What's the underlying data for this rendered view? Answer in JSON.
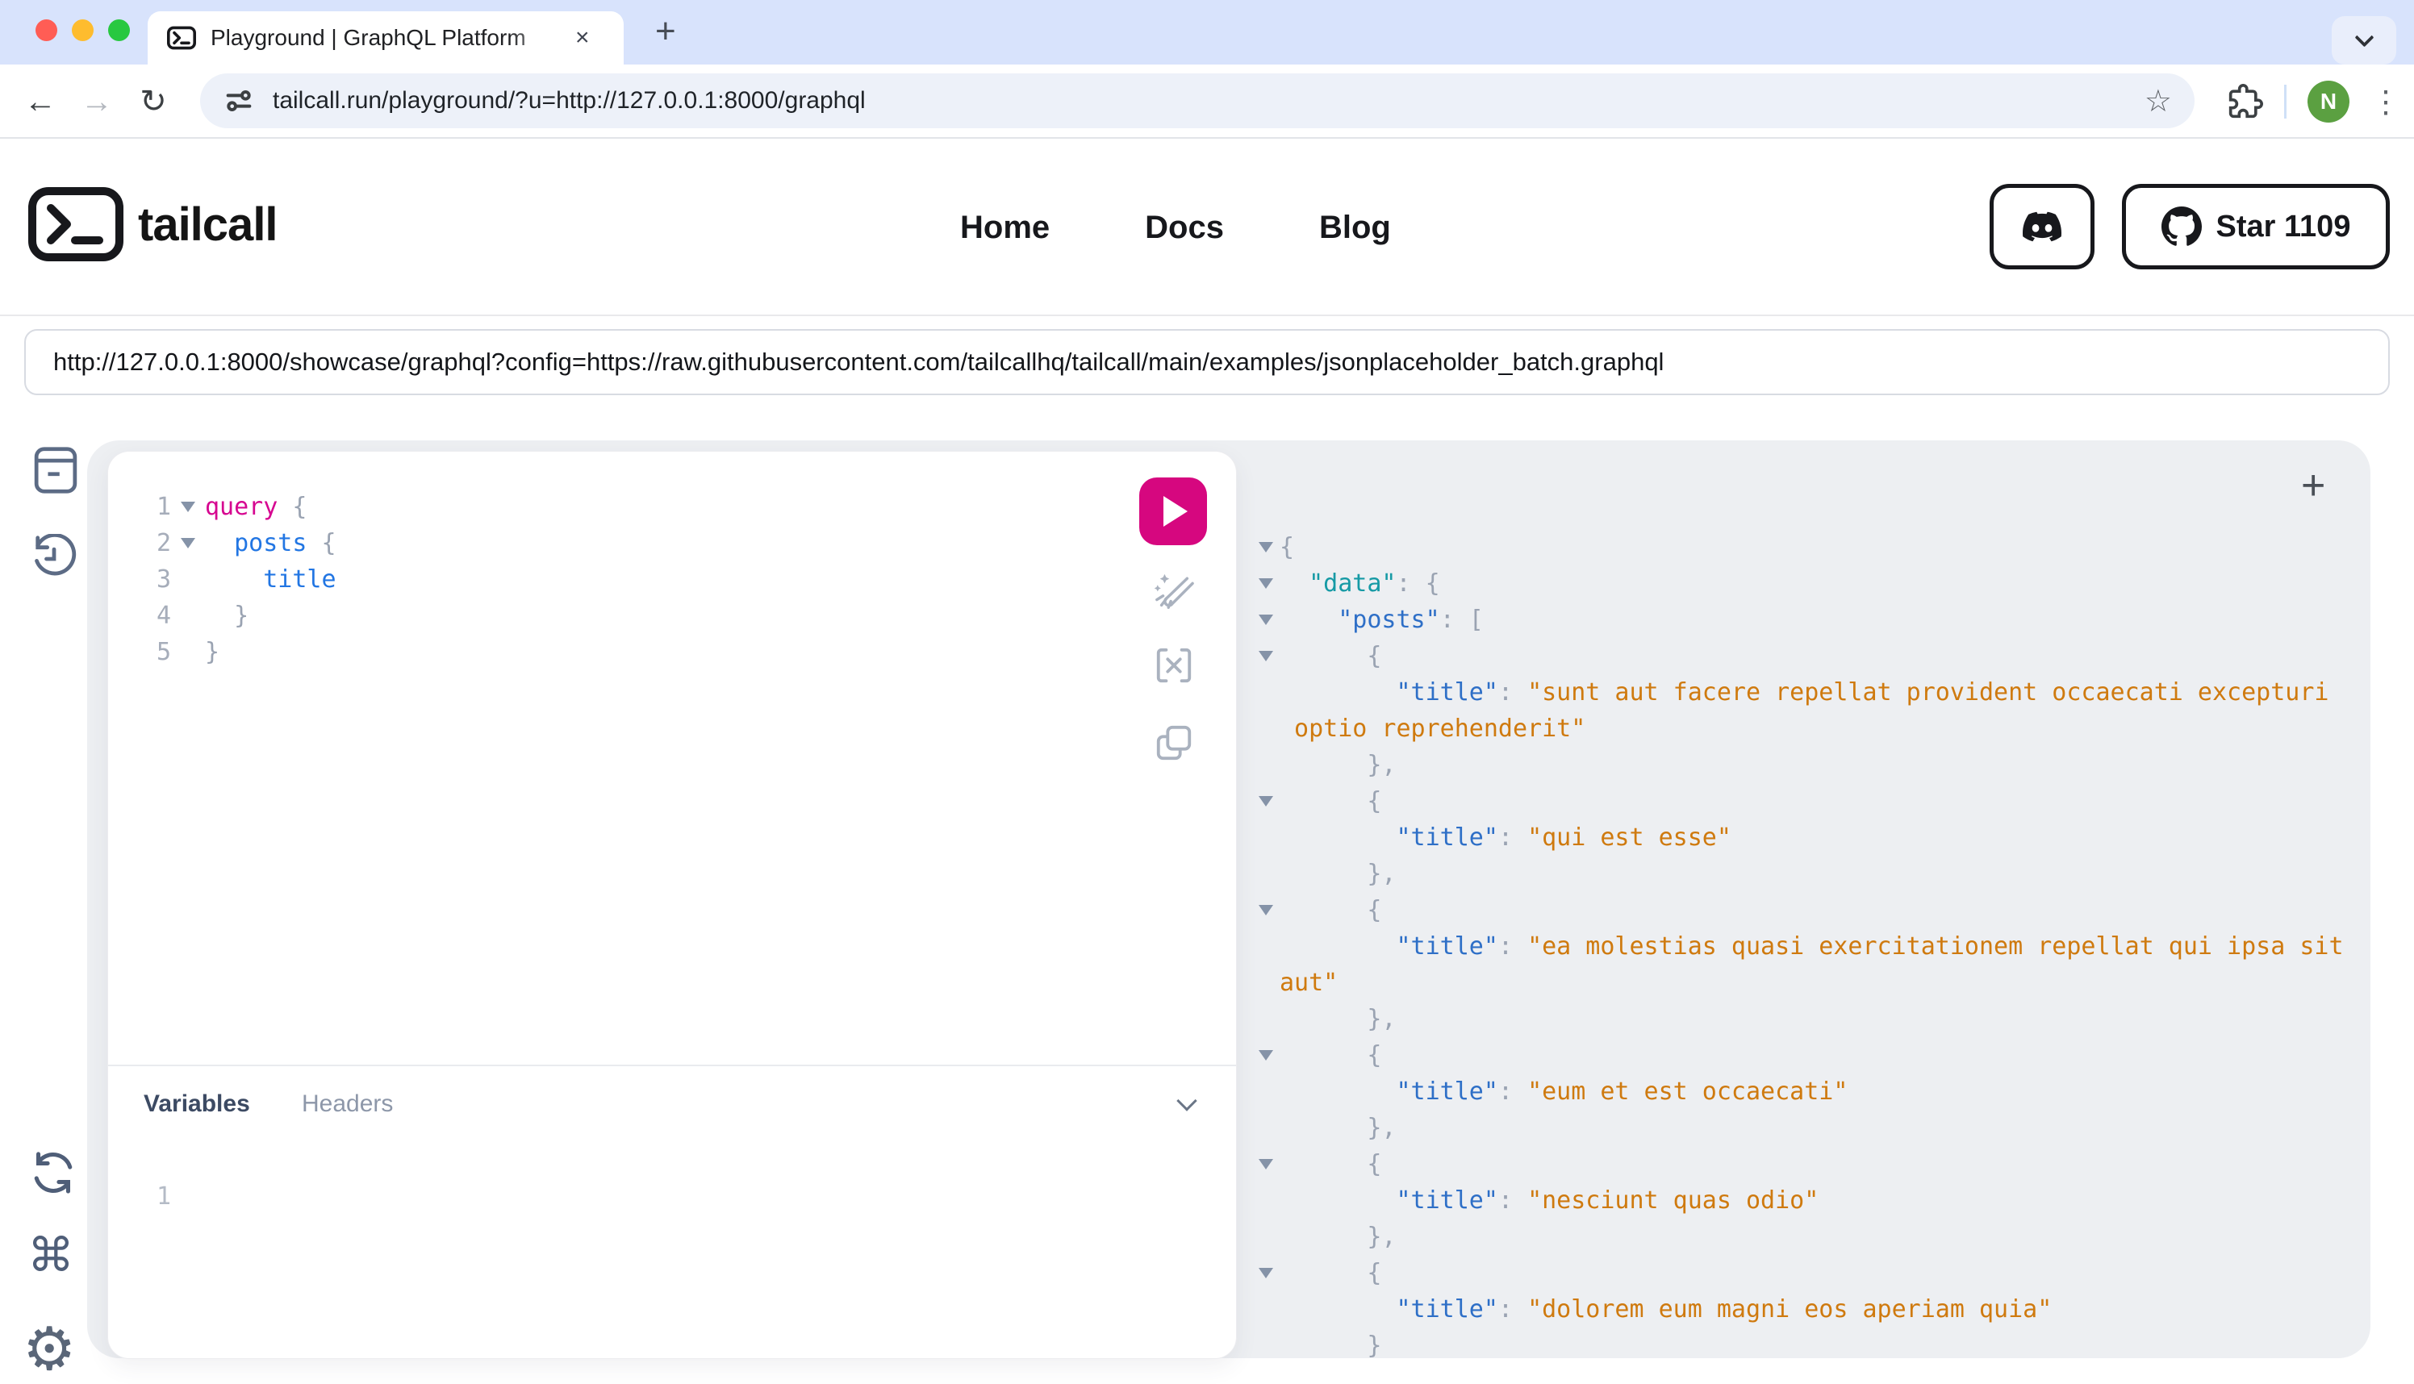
{
  "browser": {
    "tab_title": "Playground | GraphQL Platform",
    "url": "tailcall.run/playground/?u=http://127.0.0.1:8000/graphql",
    "avatar_initial": "N"
  },
  "header": {
    "brand": "tailcall",
    "nav": [
      {
        "label": "Home"
      },
      {
        "label": "Docs"
      },
      {
        "label": "Blog"
      }
    ],
    "github": {
      "label": "Star 1109"
    }
  },
  "playground": {
    "endpoint_url": "http://127.0.0.1:8000/showcase/graphql?config=https://raw.githubusercontent.com/tailcallhq/tailcall/main/examples/jsonplaceholder_batch.graphql",
    "tabs": {
      "variables": "Variables",
      "headers": "Headers"
    },
    "variables_gutter": "1",
    "response_add_label": "+",
    "query_lines": [
      {
        "num": "1",
        "fold": true,
        "segments": [
          {
            "c": "kw",
            "t": "query"
          },
          {
            "c": "punct",
            "t": " {"
          }
        ]
      },
      {
        "num": "2",
        "fold": true,
        "segments": [
          {
            "c": "punct",
            "t": "  "
          },
          {
            "c": "name",
            "t": "posts"
          },
          {
            "c": "punct",
            "t": " {"
          }
        ]
      },
      {
        "num": "3",
        "fold": false,
        "segments": [
          {
            "c": "punct",
            "t": "    "
          },
          {
            "c": "name",
            "t": "title"
          }
        ]
      },
      {
        "num": "4",
        "fold": false,
        "segments": [
          {
            "c": "punct",
            "t": "  }"
          }
        ]
      },
      {
        "num": "5",
        "fold": false,
        "segments": [
          {
            "c": "punct",
            "t": "}"
          }
        ]
      }
    ],
    "response_lines": [
      {
        "fold": true,
        "segments": [
          {
            "c": "punct",
            "t": "{"
          }
        ]
      },
      {
        "fold": true,
        "segments": [
          {
            "c": "punct",
            "t": "  "
          },
          {
            "c": "prop",
            "t": "\"data\""
          },
          {
            "c": "punct",
            "t": ": {"
          }
        ]
      },
      {
        "fold": true,
        "segments": [
          {
            "c": "punct",
            "t": "    "
          },
          {
            "c": "key",
            "t": "\"posts\""
          },
          {
            "c": "punct",
            "t": ": ["
          }
        ]
      },
      {
        "fold": true,
        "segments": [
          {
            "c": "punct",
            "t": "      {"
          }
        ]
      },
      {
        "fold": false,
        "segments": [
          {
            "c": "punct",
            "t": "        "
          },
          {
            "c": "key",
            "t": "\"title\""
          },
          {
            "c": "punct",
            "t": ": "
          },
          {
            "c": "str",
            "t": "\"sunt aut facere repellat provident occaecati excepturi"
          }
        ]
      },
      {
        "fold": false,
        "segments": [
          {
            "c": "str",
            "t": " optio reprehenderit\""
          }
        ]
      },
      {
        "fold": false,
        "segments": [
          {
            "c": "punct",
            "t": "      },"
          }
        ]
      },
      {
        "fold": true,
        "segments": [
          {
            "c": "punct",
            "t": "      {"
          }
        ]
      },
      {
        "fold": false,
        "segments": [
          {
            "c": "punct",
            "t": "        "
          },
          {
            "c": "key",
            "t": "\"title\""
          },
          {
            "c": "punct",
            "t": ": "
          },
          {
            "c": "str",
            "t": "\"qui est esse\""
          }
        ]
      },
      {
        "fold": false,
        "segments": [
          {
            "c": "punct",
            "t": "      },"
          }
        ]
      },
      {
        "fold": true,
        "segments": [
          {
            "c": "punct",
            "t": "      {"
          }
        ]
      },
      {
        "fold": false,
        "segments": [
          {
            "c": "punct",
            "t": "        "
          },
          {
            "c": "key",
            "t": "\"title\""
          },
          {
            "c": "punct",
            "t": ": "
          },
          {
            "c": "str",
            "t": "\"ea molestias quasi exercitationem repellat qui ipsa sit"
          }
        ]
      },
      {
        "fold": false,
        "segments": [
          {
            "c": "str",
            "t": "aut\""
          }
        ]
      },
      {
        "fold": false,
        "segments": [
          {
            "c": "punct",
            "t": "      },"
          }
        ]
      },
      {
        "fold": true,
        "segments": [
          {
            "c": "punct",
            "t": "      {"
          }
        ]
      },
      {
        "fold": false,
        "segments": [
          {
            "c": "punct",
            "t": "        "
          },
          {
            "c": "key",
            "t": "\"title\""
          },
          {
            "c": "punct",
            "t": ": "
          },
          {
            "c": "str",
            "t": "\"eum et est occaecati\""
          }
        ]
      },
      {
        "fold": false,
        "segments": [
          {
            "c": "punct",
            "t": "      },"
          }
        ]
      },
      {
        "fold": true,
        "segments": [
          {
            "c": "punct",
            "t": "      {"
          }
        ]
      },
      {
        "fold": false,
        "segments": [
          {
            "c": "punct",
            "t": "        "
          },
          {
            "c": "key",
            "t": "\"title\""
          },
          {
            "c": "punct",
            "t": ": "
          },
          {
            "c": "str",
            "t": "\"nesciunt quas odio\""
          }
        ]
      },
      {
        "fold": false,
        "segments": [
          {
            "c": "punct",
            "t": "      },"
          }
        ]
      },
      {
        "fold": true,
        "segments": [
          {
            "c": "punct",
            "t": "      {"
          }
        ]
      },
      {
        "fold": false,
        "segments": [
          {
            "c": "punct",
            "t": "        "
          },
          {
            "c": "key",
            "t": "\"title\""
          },
          {
            "c": "punct",
            "t": ": "
          },
          {
            "c": "str",
            "t": "\"dolorem eum magni eos aperiam quia\""
          }
        ]
      },
      {
        "fold": false,
        "segments": [
          {
            "c": "punct",
            "t": "      }"
          }
        ]
      }
    ]
  },
  "icons": {
    "tab_favicon": "tailcall-terminal-icon",
    "rail": [
      "docs-icon",
      "history-icon",
      "refetch-icon",
      "shortcuts-icon",
      "settings-gear-icon"
    ],
    "editor_tools": [
      "run-play-icon",
      "prettify-brush-icon",
      "merge-icon",
      "copy-icon"
    ],
    "header": [
      "discord-icon",
      "github-octocat-icon"
    ]
  },
  "colors": {
    "accent_pink": "#d6077f",
    "editor_keyword": "#d60690",
    "editor_field_blue": "#2276e3",
    "json_key_blue": "#2e6fc7",
    "json_data_teal": "#169aa5",
    "json_string_orange": "#cf7a0f",
    "punctuation_gray": "#9aa3b2",
    "avatar_green": "#5ba041",
    "tabstrip_blue": "#d8e3fc",
    "panel_gray": "#edeff2"
  }
}
